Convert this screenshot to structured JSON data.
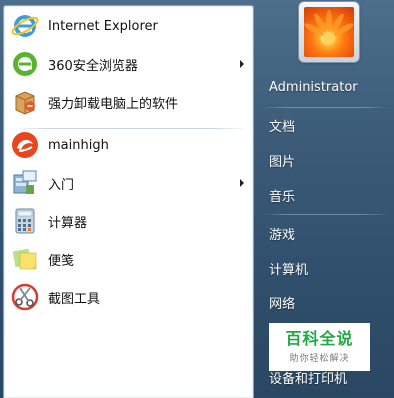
{
  "programs": [
    {
      "label": "Internet Explorer",
      "icon": "internet-explorer-icon",
      "submenu": false
    },
    {
      "label": "360安全浏览器",
      "icon": "360-browser-icon",
      "submenu": true
    },
    {
      "label": "强力卸载电脑上的软件",
      "icon": "uninstaller-icon",
      "submenu": false
    },
    {
      "label": "mainhigh",
      "icon": "mainhigh-icon",
      "submenu": false
    },
    {
      "label": "入门",
      "icon": "getting-started-icon",
      "submenu": true
    },
    {
      "label": "计算器",
      "icon": "calculator-icon",
      "submenu": false
    },
    {
      "label": "便笺",
      "icon": "sticky-notes-icon",
      "submenu": false
    },
    {
      "label": "截图工具",
      "icon": "snipping-tool-icon",
      "submenu": false
    }
  ],
  "right_menu": {
    "user": "Administrator",
    "items": [
      "文档",
      "图片",
      "音乐",
      "游戏",
      "计算机",
      "网络",
      "设备和打印机"
    ]
  },
  "watermark": {
    "title": "百科全说",
    "subtitle": "助你轻松解决"
  },
  "colors": {
    "frame": "#3b5b78",
    "pane": "#ffffff",
    "watermark_green": "#22a946"
  }
}
